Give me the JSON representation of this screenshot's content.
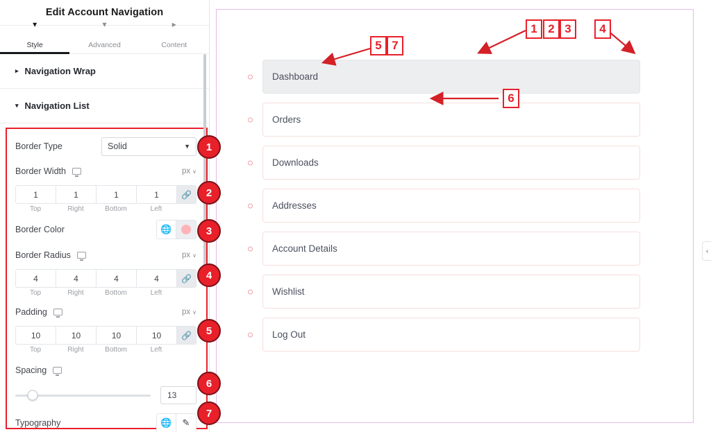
{
  "panel": {
    "title": "Edit Account Navigation",
    "tabs": [
      {
        "label": "Style",
        "icon": "brush-icon",
        "active": true
      },
      {
        "label": "Advanced",
        "icon": "sliders-icon",
        "active": false
      },
      {
        "label": "Content",
        "icon": "pencil-icon",
        "active": false
      }
    ],
    "sections": [
      {
        "label": "Navigation Wrap",
        "caret": "▸",
        "expanded": false
      },
      {
        "label": "Navigation List",
        "caret": "▾",
        "expanded": true
      }
    ],
    "collapse_handle": "‹"
  },
  "controls": {
    "border_type": {
      "label": "Border Type",
      "value": "Solid",
      "arrow": "▼"
    },
    "border_width": {
      "label": "Border Width",
      "unit": "px",
      "unit_caret": "∨",
      "values": [
        "1",
        "1",
        "1",
        "1"
      ],
      "sides": [
        "Top",
        "Right",
        "Bottom",
        "Left"
      ],
      "link_icon": "🔗"
    },
    "border_color": {
      "label": "Border Color",
      "globe_icon": "🌐",
      "swatch_color": "#ffb3b8"
    },
    "border_radius": {
      "label": "Border Radius",
      "unit": "px",
      "unit_caret": "∨",
      "values": [
        "4",
        "4",
        "4",
        "4"
      ],
      "sides": [
        "Top",
        "Right",
        "Bottom",
        "Left"
      ],
      "link_icon": "🔗"
    },
    "padding": {
      "label": "Padding",
      "unit": "px",
      "unit_caret": "∨",
      "values": [
        "10",
        "10",
        "10",
        "10"
      ],
      "sides": [
        "Top",
        "Right",
        "Bottom",
        "Left"
      ],
      "link_icon": "🔗"
    },
    "spacing": {
      "label": "Spacing",
      "value": "13",
      "slider_percent": 13
    },
    "typography": {
      "label": "Typography",
      "globe_icon": "🌐",
      "edit_icon": "✎"
    }
  },
  "preview": {
    "nav_items": [
      {
        "label": "Dashboard",
        "active": true
      },
      {
        "label": "Orders",
        "active": false
      },
      {
        "label": "Downloads",
        "active": false
      },
      {
        "label": "Addresses",
        "active": false
      },
      {
        "label": "Account Details",
        "active": false
      },
      {
        "label": "Wishlist",
        "active": false
      },
      {
        "label": "Log Out",
        "active": false
      }
    ]
  },
  "annotations": {
    "badges": [
      "1",
      "2",
      "3",
      "4",
      "5",
      "6",
      "7"
    ],
    "callouts": [
      {
        "num": "1"
      },
      {
        "num": "2"
      },
      {
        "num": "3"
      },
      {
        "num": "4"
      },
      {
        "num": "5"
      },
      {
        "num": "6"
      },
      {
        "num": "7"
      }
    ]
  },
  "colors": {
    "accent_red": "#e8202a",
    "preview_border": "#e8b9e8",
    "item_border": "#f7dede"
  }
}
